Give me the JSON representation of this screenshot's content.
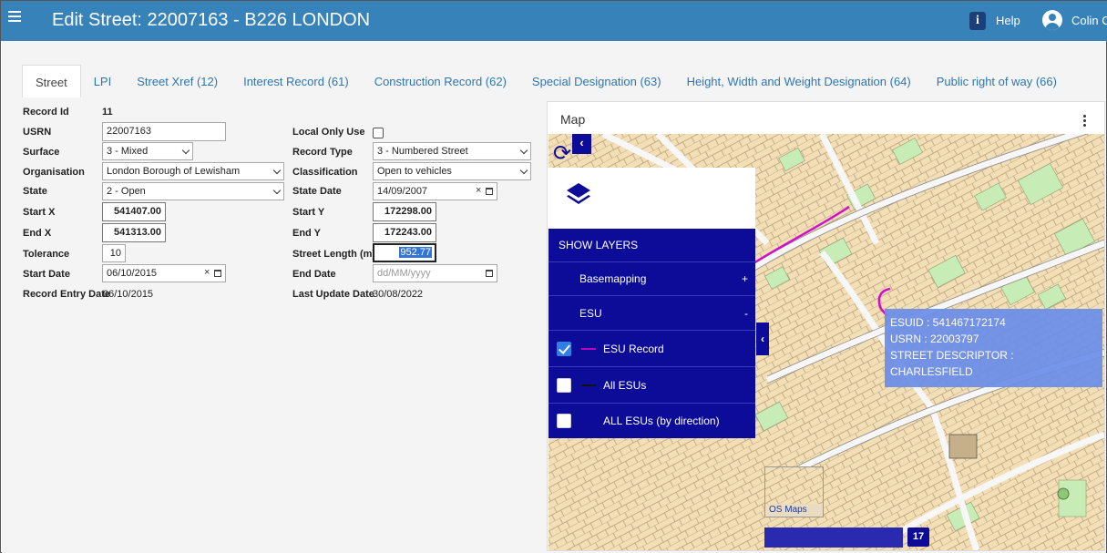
{
  "header": {
    "title": "Edit Street: 22007163 - B226 LONDON",
    "help_label": "Help",
    "user_name": "Colin C",
    "bg_color": "#3782b8"
  },
  "tabs": [
    {
      "label": "Street",
      "active": true
    },
    {
      "label": "LPI"
    },
    {
      "label": "Street Xref (12)"
    },
    {
      "label": "Interest Record (61)"
    },
    {
      "label": "Construction Record (62)"
    },
    {
      "label": "Special Designation (63)"
    },
    {
      "label": "Height, Width and Weight Designation (64)"
    },
    {
      "label": "Public right of way (66)"
    }
  ],
  "form": {
    "record_id_label": "Record Id",
    "record_id": "11",
    "usrn_label": "USRN",
    "usrn": "22007163",
    "surface_label": "Surface",
    "surface": "3 - Mixed",
    "organisation_label": "Organisation",
    "organisation": "London Borough of Lewisham",
    "state_label": "State",
    "state": "2 - Open",
    "start_x_label": "Start X",
    "start_x": "541407.00",
    "end_x_label": "End X",
    "end_x": "541313.00",
    "tolerance_label": "Tolerance",
    "tolerance": "10",
    "start_date_label": "Start Date",
    "start_date": "06/10/2015",
    "record_entry_date_label": "Record Entry Date",
    "record_entry_date": "06/10/2015",
    "local_only_label": "Local Only Use",
    "local_only": false,
    "record_type_label": "Record Type",
    "record_type": "3 - Numbered Street",
    "classification_label": "Classification",
    "classification": "Open to vehicles",
    "state_date_label": "State Date",
    "state_date": "14/09/2007",
    "start_y_label": "Start Y",
    "start_y": "172298.00",
    "end_y_label": "End Y",
    "end_y": "172243.00",
    "street_length_label": "Street Length (m)",
    "street_length": "952.77",
    "end_date_label": "End Date",
    "end_date_placeholder": "dd/MM/yyyy",
    "last_update_label": "Last Update Date",
    "last_update": "30/08/2022"
  },
  "map": {
    "title": "Map",
    "layers": {
      "show_label": "SHOW LAYERS",
      "items": [
        {
          "label": "Basemapping",
          "toggle": "+"
        },
        {
          "label": "ESU",
          "toggle": "-"
        },
        {
          "label": "ESU Record",
          "checked": true,
          "swatch": "#c000c0"
        },
        {
          "label": "All ESUs",
          "checked": false,
          "swatch": "#111111"
        },
        {
          "label": "ALL ESUs (by direction)",
          "checked": false
        }
      ]
    },
    "tooltip": {
      "esuid": "ESUID : 541467172174",
      "usrn": "USRN : 22003797",
      "descriptor": "STREET DESCRIPTOR : CHARLESFIELD"
    },
    "basemap_toggle_label": "OS Maps",
    "scale_value": "17",
    "accent": "#0c0c98"
  }
}
